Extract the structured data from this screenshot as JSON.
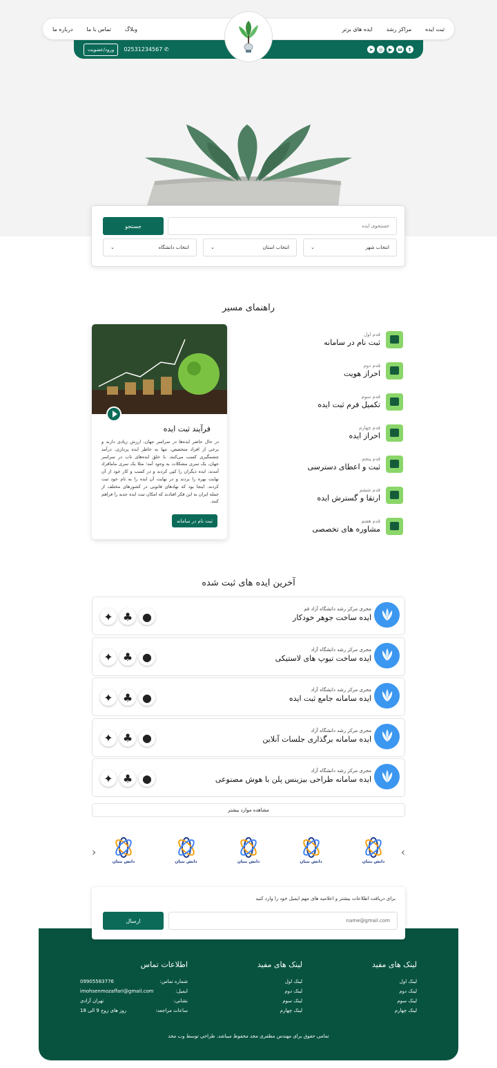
{
  "nav": {
    "right_items": [
      "ثبت ایده",
      "مراکز رشد",
      "ایده های برتر"
    ],
    "left_items": [
      "وبلاگ",
      "تماس با ما",
      "درباره ما"
    ],
    "phone": "02531234567",
    "login": "ورود/عضویت",
    "socials": [
      "twitter-icon",
      "whatsapp-icon",
      "youtube-icon",
      "instagram-icon",
      "telegram-icon"
    ]
  },
  "search": {
    "placeholder": "جستجوی ایده",
    "button": "جستجو",
    "selects": [
      "انتخاب شهر",
      "انتخاب استان",
      "انتخاب دانشگاه"
    ]
  },
  "guide": {
    "title": "راهنمای مسیر",
    "steps": [
      {
        "k": "قدم اول",
        "t": "ثبت نام در سامانه"
      },
      {
        "k": "قدم دوم",
        "t": "احراز هویت"
      },
      {
        "k": "قدم سوم",
        "t": "تکمیل فرم ثبت ایده"
      },
      {
        "k": "قدم چهارم",
        "t": "احراز ایده"
      },
      {
        "k": "قدم پنجم",
        "t": "ثبت و اعطای دسترسی"
      },
      {
        "k": "قدم ششم",
        "t": "ارتقا و گسترش ایده"
      },
      {
        "k": "قدم هفتم",
        "t": "مشاوره های تخصصی"
      }
    ],
    "card_title": "فرآیند ثبت ایده",
    "card_text": "در حال حاضر ایده‌ها در سراسر جهان، ارزش زیادی دارند و برخی از افراد متخصص، تنها به خاطر ایده پردازی، درآمد چشمگیری کسب می‌کنند. با خلق ایده‌های ناب در سراسر جهان، یک سری مشکلات به وجود آمد؛ مثلا یک سری ماماقراد آمدند، ایده دیگران را کپی کردند و در کسب و کار خود از آن نهایت بهره را بردند و در نهایت آن ایده را به نام خود ثبت کردند. اینجا بود که نهادهای قانونی در کشورهای مختلف از جمله ایران به این فکر افتادند که امکان ثبت ایده جدید را فراهم کنند.",
    "card_button": "ثبت نام در سامانه"
  },
  "ideas": {
    "title": "آخرین ایده های ثبت شده",
    "items": [
      {
        "k": "مجری مرکز رشد دانشگاه آزاد قم",
        "t": "ایده ساخت جوهر خودکار"
      },
      {
        "k": "مجری مرکز رشد دانشگاه آزاد",
        "t": "ایده ساخت تیوپ های لاستیکی"
      },
      {
        "k": "مجری مرکز رشد دانشگاه آزاد",
        "t": "ایده سامانه جامع ثبت ایده"
      },
      {
        "k": "مجری مرکز رشد دانشگاه آزاد",
        "t": "ایده سامانه برگذاری جلسات آنلاین"
      },
      {
        "k": "مجری مرکز رشد دانشگاه آزاد",
        "t": "ایده سامانه طراحی بیزینس پلن با هوش مصنوعی"
      }
    ],
    "more": "مشاهده موارد بیشتر"
  },
  "partners": {
    "name": "دانش بنیان",
    "count": 5
  },
  "newsletter": {
    "label": "برای دریافت اطلاعات بیشتر و اعلامیه های مهم ایمیل خود را وارد کنید",
    "placeholder": "name@gmail.com",
    "button": "ارسال"
  },
  "footer": {
    "col1": {
      "title": "لینک های مفید",
      "links": [
        "لینک اول",
        "لینک دوم",
        "لینک سوم",
        "لینک چهارم"
      ]
    },
    "col2": {
      "title": "لینک های مفید",
      "links": [
        "لینک اول",
        "لینک دوم",
        "لینک سوم",
        "لینک چهارم"
      ]
    },
    "contact": {
      "title": "اطلاعات تماس",
      "rows": [
        {
          "k": "شماره تماس:",
          "v": "09905583776"
        },
        {
          "k": "ایمیل:",
          "v": "imohsenmozaffari@gmail.com"
        },
        {
          "k": "نشانی:",
          "v": "تهران آزادی"
        },
        {
          "k": "ساعات مراجعه:",
          "v": "روز های زوج 9 الی 18"
        }
      ]
    },
    "copyright": "تمامی حقوق برای مهندس مظفری مجد محفوظ میباشد. طراحی توسط وب مجد"
  },
  "colors": {
    "primary": "#0b6b58",
    "footer": "#08533f",
    "step_icon": "#8bd66a"
  }
}
